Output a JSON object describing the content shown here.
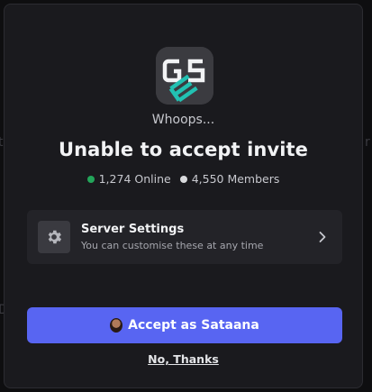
{
  "invite": {
    "whoops": "Whoops...",
    "title": "Unable to accept invite",
    "online_count": "1,274 Online",
    "member_count": "4,550 Members",
    "online_dot_color": "#23a55a",
    "member_dot_color": "#d9dadd"
  },
  "server": {
    "icon": "gse-server-logo",
    "icon_letters": [
      "G",
      "S",
      "E"
    ]
  },
  "settings": {
    "title": "Server Settings",
    "subtitle": "You can customise these at any time",
    "icon": "gear-icon",
    "arrow_icon": "chevron-right-icon"
  },
  "actions": {
    "accept_label": "Accept as Sataana",
    "accept_color": "#5865f2",
    "decline_label": "No, Thanks"
  }
}
